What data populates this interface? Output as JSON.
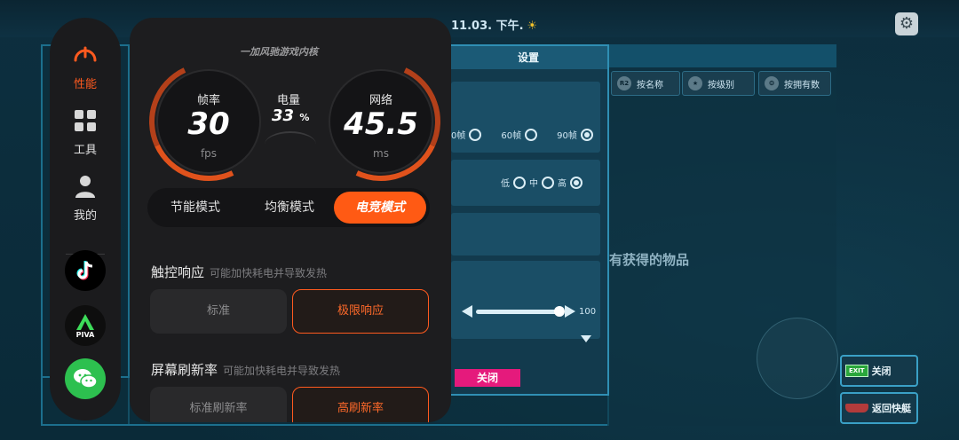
{
  "game": {
    "status_time": "11.03. 下午.",
    "sun_icon": "sun-icon",
    "tabs": [
      {
        "icon": "R2",
        "label": "按名称"
      },
      {
        "icon": "★",
        "label": "按级别"
      },
      {
        "icon": "❂",
        "label": "按拥有数"
      }
    ],
    "empty_text": "有获得的物品",
    "close_label": "关闭",
    "exit_tag": "EXIT",
    "return_label": "返回快艇"
  },
  "settings": {
    "title": "设置",
    "fps_options": [
      {
        "label": "0帧",
        "selected": false
      },
      {
        "label": "60帧",
        "selected": false
      },
      {
        "label": "90帧",
        "selected": true
      }
    ],
    "quality_options": [
      {
        "label": "低",
        "selected": false
      },
      {
        "label": "中",
        "selected": false
      },
      {
        "label": "高",
        "selected": true
      }
    ],
    "volume_value": "100",
    "close_label": "关闭"
  },
  "rail": {
    "items": [
      {
        "name": "performance",
        "label": "性能",
        "icon": "speedometer-icon",
        "active": true
      },
      {
        "name": "tools",
        "label": "工具",
        "icon": "grid-icon",
        "active": false
      },
      {
        "name": "mine",
        "label": "我的",
        "icon": "person-icon",
        "active": false
      }
    ],
    "apps": [
      {
        "name": "tiktok",
        "icon": "tiktok-icon"
      },
      {
        "name": "piva",
        "icon": "piva-icon",
        "text": "PIVA"
      },
      {
        "name": "wechat",
        "icon": "wechat-icon"
      }
    ]
  },
  "panel": {
    "brand": "一加风驰游戏内核",
    "fps": {
      "label": "帧率",
      "value": "30",
      "unit": "fps"
    },
    "battery": {
      "label": "电量",
      "value": "33",
      "unit": "%"
    },
    "network": {
      "label": "网络",
      "value": "45.5",
      "unit": "ms"
    },
    "modes": [
      {
        "label": "节能模式",
        "active": false
      },
      {
        "label": "均衡模式",
        "active": false
      },
      {
        "label": "电竞模式",
        "active": true
      }
    ],
    "touch": {
      "title": "触控响应",
      "subtitle": "可能加快耗电并导致发热",
      "options": [
        {
          "label": "标准",
          "active": false
        },
        {
          "label": "极限响应",
          "active": true
        }
      ]
    },
    "refresh": {
      "title": "屏幕刷新率",
      "subtitle": "可能加快耗电并导致发热",
      "options": [
        {
          "label": "标准刷新率",
          "active": false
        },
        {
          "label": "高刷新率",
          "active": true
        }
      ]
    }
  },
  "colors": {
    "accent": "#ff5a14",
    "panel_bg": "#1d1d1f",
    "game_bg": "#0b2a3a",
    "pink": "#e51a7c"
  }
}
